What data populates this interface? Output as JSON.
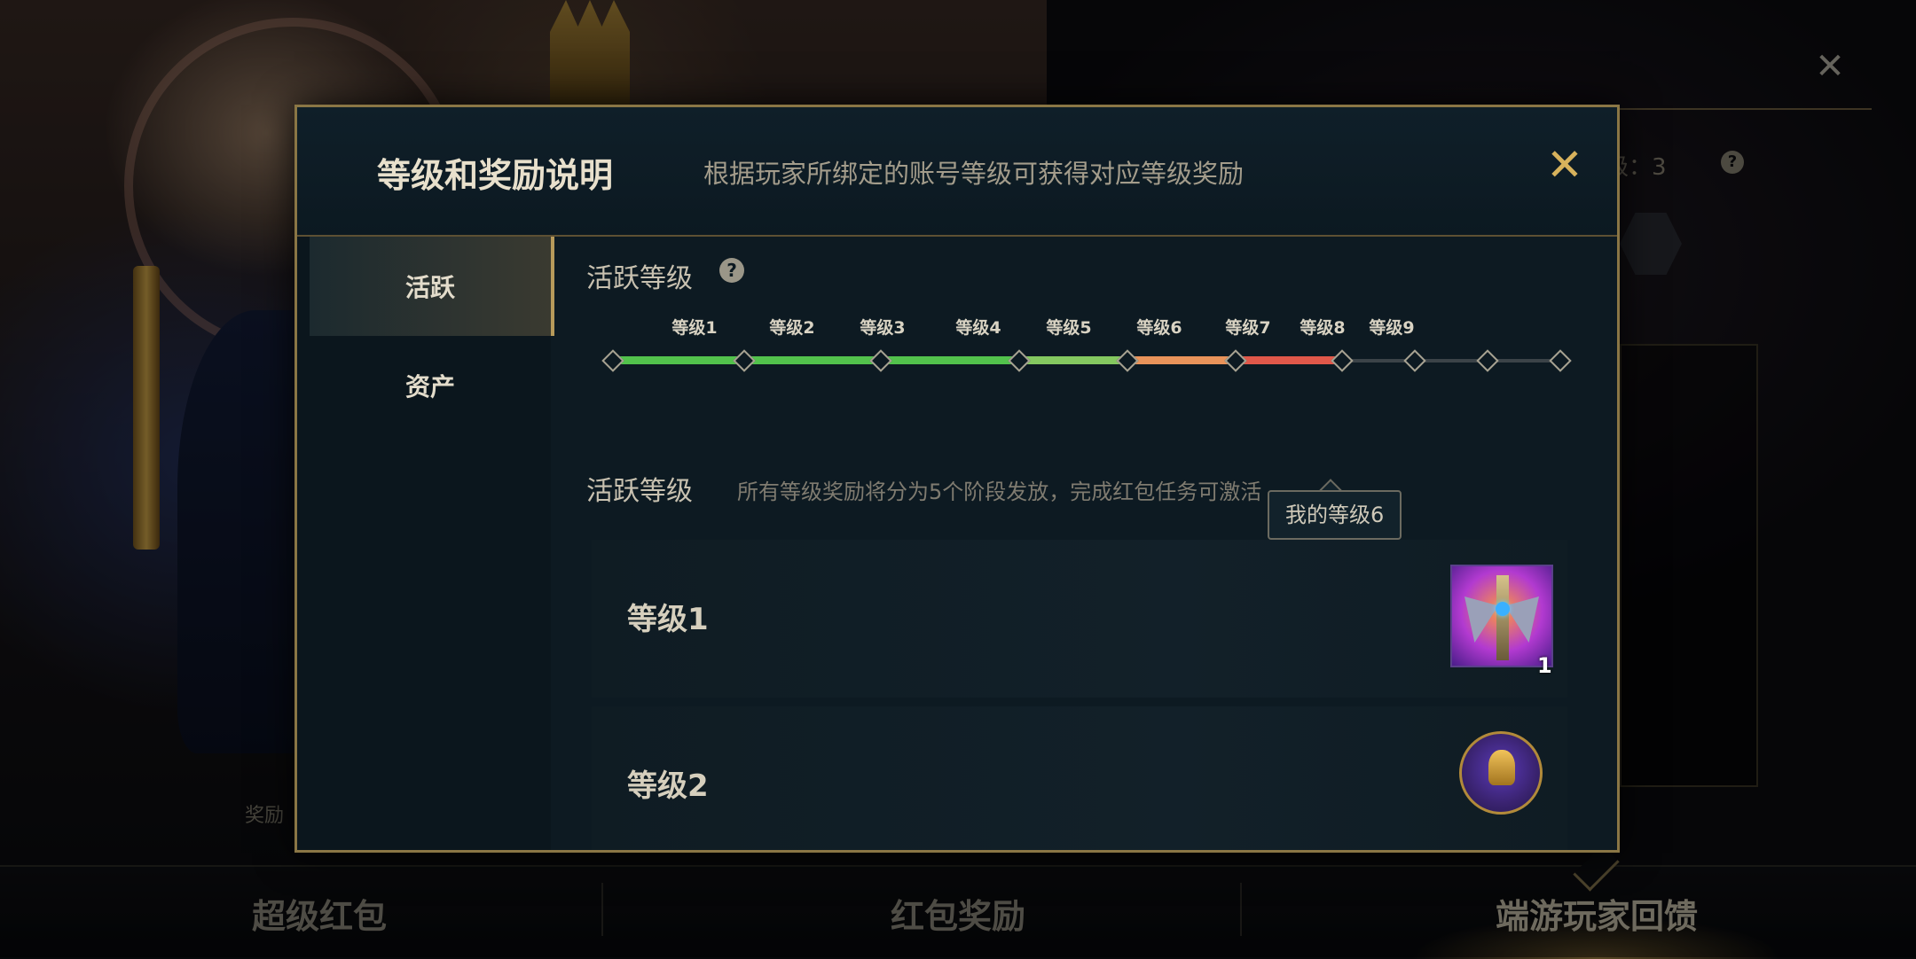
{
  "background": {
    "close_icon": "close-icon",
    "level_text": "级：3",
    "help_glyph": "?",
    "reward_text": "奖励"
  },
  "bottom_tabs": [
    {
      "label": "超级红包",
      "active": false
    },
    {
      "label": "红包奖励",
      "active": false
    },
    {
      "label": "端游玩家回馈",
      "active": true
    }
  ],
  "modal": {
    "title": "等级和奖励说明",
    "subtitle": "根据玩家所绑定的账号等级可获得对应等级奖励",
    "close_glyph": "✕",
    "side_nav": [
      {
        "label": "活跃",
        "active": true
      },
      {
        "label": "资产",
        "active": false
      }
    ],
    "section_title": "活跃等级",
    "help_glyph": "?",
    "levels": [
      "等级1",
      "等级2",
      "等级3",
      "等级4",
      "等级5",
      "等级6",
      "等级7",
      "等级8",
      "等级9"
    ],
    "current_level": 6,
    "my_level_label": "我的等级6",
    "section2_title": "活跃等级",
    "section2_desc": "所有等级奖励将分为5个阶段发放，完成红包任务可激活",
    "rewards": [
      {
        "label": "等级1",
        "icon": "sword-wings-icon",
        "count": "1"
      },
      {
        "label": "等级2",
        "icon": "golden-helmet-icon",
        "count": ""
      }
    ]
  },
  "colors": {
    "accent_gold": "#d7b25c",
    "track_green": "#52c24c",
    "track_light_green": "#84c860",
    "track_orange": "#e8935a",
    "track_red": "#e0584a",
    "track_gray": "#3b4348"
  }
}
